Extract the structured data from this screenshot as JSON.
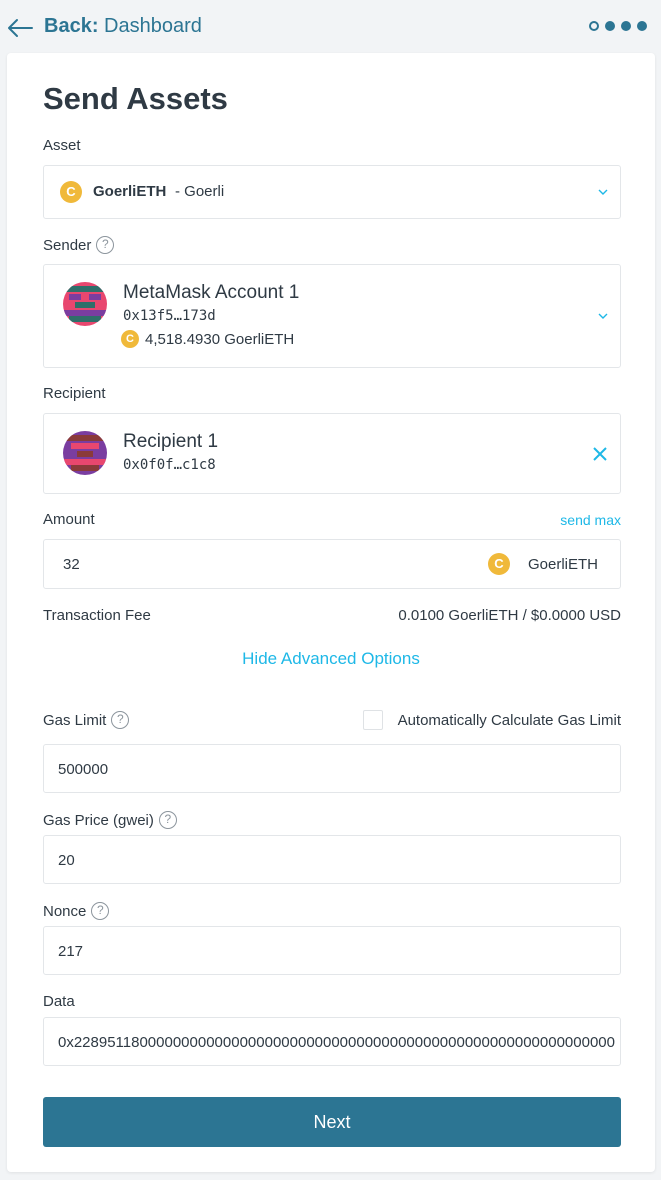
{
  "nav": {
    "back_prefix": "Back:",
    "back_target": "Dashboard"
  },
  "title": "Send Assets",
  "asset": {
    "label": "Asset",
    "symbol": "GoerliETH",
    "network": "- Goerli"
  },
  "sender": {
    "label": "Sender",
    "name": "MetaMask Account 1",
    "address": "0x13f5…173d",
    "balance": "4,518.4930 GoerliETH"
  },
  "recipient": {
    "label": "Recipient",
    "name": "Recipient 1",
    "address": "0x0f0f…c1c8"
  },
  "amount": {
    "label": "Amount",
    "send_max": "send max",
    "value": "32",
    "unit": "GoerliETH"
  },
  "fee": {
    "label": "Transaction Fee",
    "value": "0.0100 GoerliETH / $0.0000 USD"
  },
  "advanced_toggle": "Hide Advanced Options",
  "gas_limit": {
    "label": "Gas Limit",
    "auto_label": "Automatically Calculate Gas Limit",
    "auto_checked": false,
    "value": "500000"
  },
  "gas_price": {
    "label": "Gas Price (gwei)",
    "value": "20"
  },
  "nonce": {
    "label": "Nonce",
    "value": "217"
  },
  "data_field": {
    "label": "Data",
    "value": "0x22895118000000000000000000000000000000000000000000000000000000000"
  },
  "next_button": "Next",
  "colors": {
    "primary": "#2c7593",
    "link": "#1eb8e7",
    "coin": "#f0b93a"
  }
}
